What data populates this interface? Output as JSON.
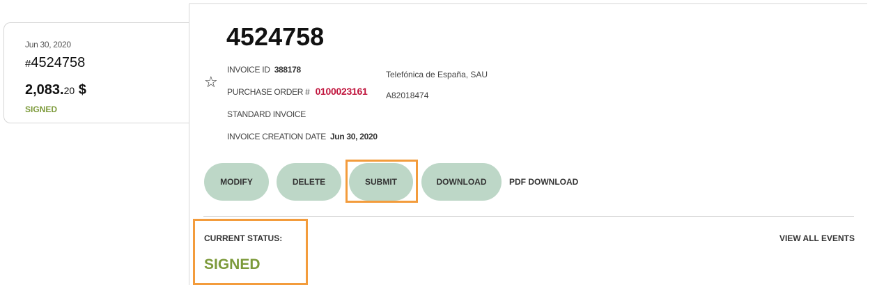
{
  "summary_card": {
    "date": "Jun 30, 2020",
    "hash": "#",
    "number": "4524758",
    "amount_int": "2,083.",
    "amount_dec": "20",
    "currency": "$",
    "status": "SIGNED"
  },
  "invoice": {
    "title": "4524758",
    "invoice_id_label": "INVOICE ID",
    "invoice_id": "388178",
    "po_label": "PURCHASE ORDER #",
    "po_number": "0100023161",
    "type": "STANDARD INVOICE",
    "creation_label": "INVOICE CREATION DATE",
    "creation_date": "Jun 30, 2020",
    "vendor_name": "Telefónica de España, SAU",
    "vendor_tax_id": "A82018474"
  },
  "actions": {
    "modify": "MODIFY",
    "delete": "DELETE",
    "submit": "SUBMIT",
    "download": "DOWNLOAD",
    "pdf_download": "PDF DOWNLOAD"
  },
  "status": {
    "label": "CURRENT STATUS:",
    "value": "SIGNED",
    "view_events": "VIEW ALL EVENTS"
  },
  "colors": {
    "signed_green": "#7c9a3a",
    "po_red": "#c0143c",
    "button_bg": "#bdd7c7",
    "highlight": "#f39c3c"
  }
}
